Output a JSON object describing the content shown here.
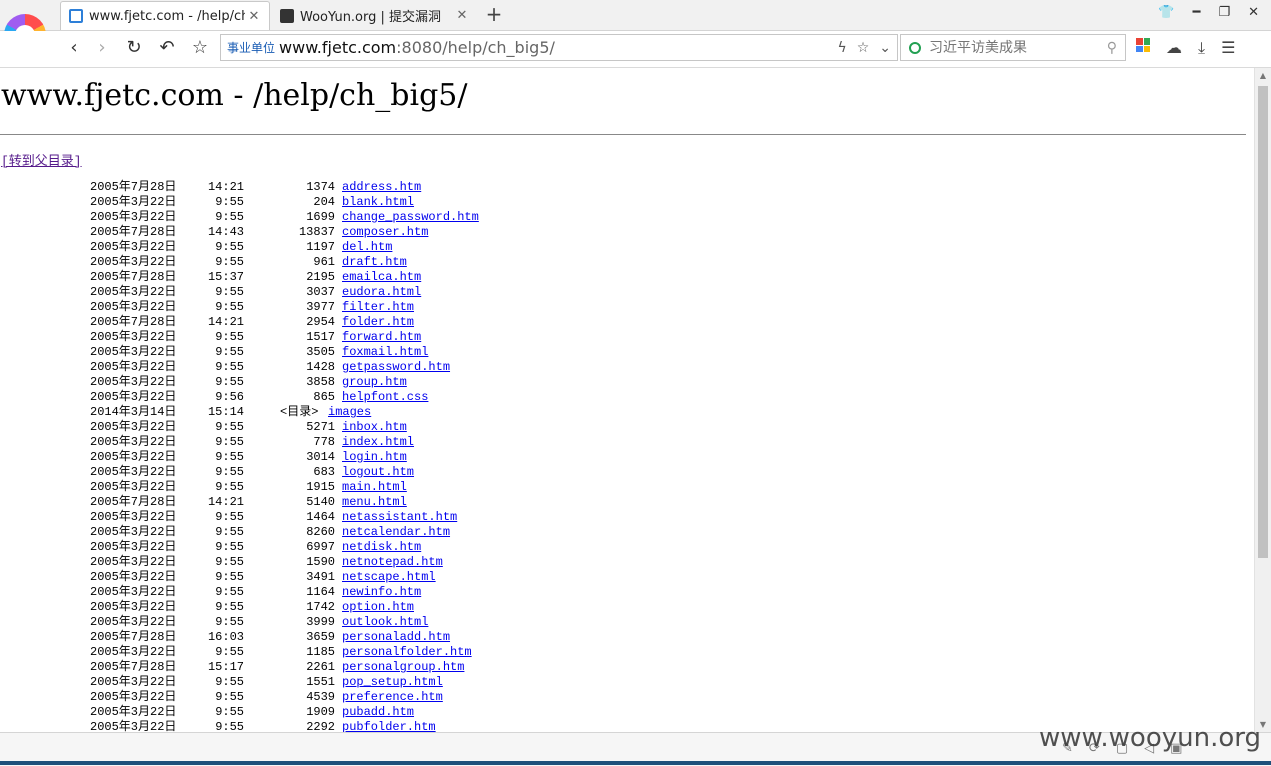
{
  "browser": {
    "tabs": [
      {
        "title": "www.fjetc.com - /help/ch_b",
        "active": true
      },
      {
        "title": "WooYun.org | 提交漏洞",
        "active": false
      }
    ],
    "address": {
      "badge": "事业单位",
      "host": "www.fjetc.com",
      "rest": ":8080/help/ch_big5/"
    },
    "search_placeholder": "习近平访美成果"
  },
  "page": {
    "heading": "www.fjetc.com - /help/ch_big5/",
    "parent_link": "[转到父目录]",
    "dir_marker": "<目录>"
  },
  "listing": [
    {
      "date": "2005年7月28日",
      "time": "14:21",
      "size": "1374",
      "name": "address.htm"
    },
    {
      "date": "2005年3月22日",
      "time": "9:55",
      "size": "204",
      "name": "blank.html"
    },
    {
      "date": "2005年3月22日",
      "time": "9:55",
      "size": "1699",
      "name": "change_password.htm"
    },
    {
      "date": "2005年7月28日",
      "time": "14:43",
      "size": "13837",
      "name": "composer.htm"
    },
    {
      "date": "2005年3月22日",
      "time": "9:55",
      "size": "1197",
      "name": "del.htm"
    },
    {
      "date": "2005年3月22日",
      "time": "9:55",
      "size": "961",
      "name": "draft.htm"
    },
    {
      "date": "2005年7月28日",
      "time": "15:37",
      "size": "2195",
      "name": "emailca.htm"
    },
    {
      "date": "2005年3月22日",
      "time": "9:55",
      "size": "3037",
      "name": "eudora.html"
    },
    {
      "date": "2005年3月22日",
      "time": "9:55",
      "size": "3977",
      "name": "filter.htm"
    },
    {
      "date": "2005年7月28日",
      "time": "14:21",
      "size": "2954",
      "name": "folder.htm"
    },
    {
      "date": "2005年3月22日",
      "time": "9:55",
      "size": "1517",
      "name": "forward.htm"
    },
    {
      "date": "2005年3月22日",
      "time": "9:55",
      "size": "3505",
      "name": "foxmail.html"
    },
    {
      "date": "2005年3月22日",
      "time": "9:55",
      "size": "1428",
      "name": "getpassword.htm"
    },
    {
      "date": "2005年3月22日",
      "time": "9:55",
      "size": "3858",
      "name": "group.htm"
    },
    {
      "date": "2005年3月22日",
      "time": "9:56",
      "size": "865",
      "name": "helpfont.css"
    },
    {
      "date": "2014年3月14日",
      "time": "15:14",
      "size": "",
      "name": "images",
      "dir": true
    },
    {
      "date": "2005年3月22日",
      "time": "9:55",
      "size": "5271",
      "name": "inbox.htm"
    },
    {
      "date": "2005年3月22日",
      "time": "9:55",
      "size": "778",
      "name": "index.html"
    },
    {
      "date": "2005年3月22日",
      "time": "9:55",
      "size": "3014",
      "name": "login.htm"
    },
    {
      "date": "2005年3月22日",
      "time": "9:55",
      "size": "683",
      "name": "logout.htm"
    },
    {
      "date": "2005年3月22日",
      "time": "9:55",
      "size": "1915",
      "name": "main.html"
    },
    {
      "date": "2005年7月28日",
      "time": "14:21",
      "size": "5140",
      "name": "menu.html"
    },
    {
      "date": "2005年3月22日",
      "time": "9:55",
      "size": "1464",
      "name": "netassistant.htm"
    },
    {
      "date": "2005年3月22日",
      "time": "9:55",
      "size": "8260",
      "name": "netcalendar.htm"
    },
    {
      "date": "2005年3月22日",
      "time": "9:55",
      "size": "6997",
      "name": "netdisk.htm"
    },
    {
      "date": "2005年3月22日",
      "time": "9:55",
      "size": "1590",
      "name": "netnotepad.htm"
    },
    {
      "date": "2005年3月22日",
      "time": "9:55",
      "size": "3491",
      "name": "netscape.html"
    },
    {
      "date": "2005年3月22日",
      "time": "9:55",
      "size": "1164",
      "name": "newinfo.htm"
    },
    {
      "date": "2005年3月22日",
      "time": "9:55",
      "size": "1742",
      "name": "option.htm"
    },
    {
      "date": "2005年3月22日",
      "time": "9:55",
      "size": "3999",
      "name": "outlook.html"
    },
    {
      "date": "2005年7月28日",
      "time": "16:03",
      "size": "3659",
      "name": "personaladd.htm"
    },
    {
      "date": "2005年3月22日",
      "time": "9:55",
      "size": "1185",
      "name": "personalfolder.htm"
    },
    {
      "date": "2005年7月28日",
      "time": "15:17",
      "size": "2261",
      "name": "personalgroup.htm"
    },
    {
      "date": "2005年3月22日",
      "time": "9:55",
      "size": "1551",
      "name": "pop_setup.html"
    },
    {
      "date": "2005年3月22日",
      "time": "9:55",
      "size": "4539",
      "name": "preference.htm"
    },
    {
      "date": "2005年3月22日",
      "time": "9:55",
      "size": "1909",
      "name": "pubadd.htm"
    },
    {
      "date": "2005年3月22日",
      "time": "9:55",
      "size": "2292",
      "name": "pubfolder.htm"
    }
  ],
  "watermark": "www.wooyun.org",
  "colors": {
    "link": "#0000ee",
    "visited": "#551a8b",
    "addr_badge": "#1a5db4"
  }
}
